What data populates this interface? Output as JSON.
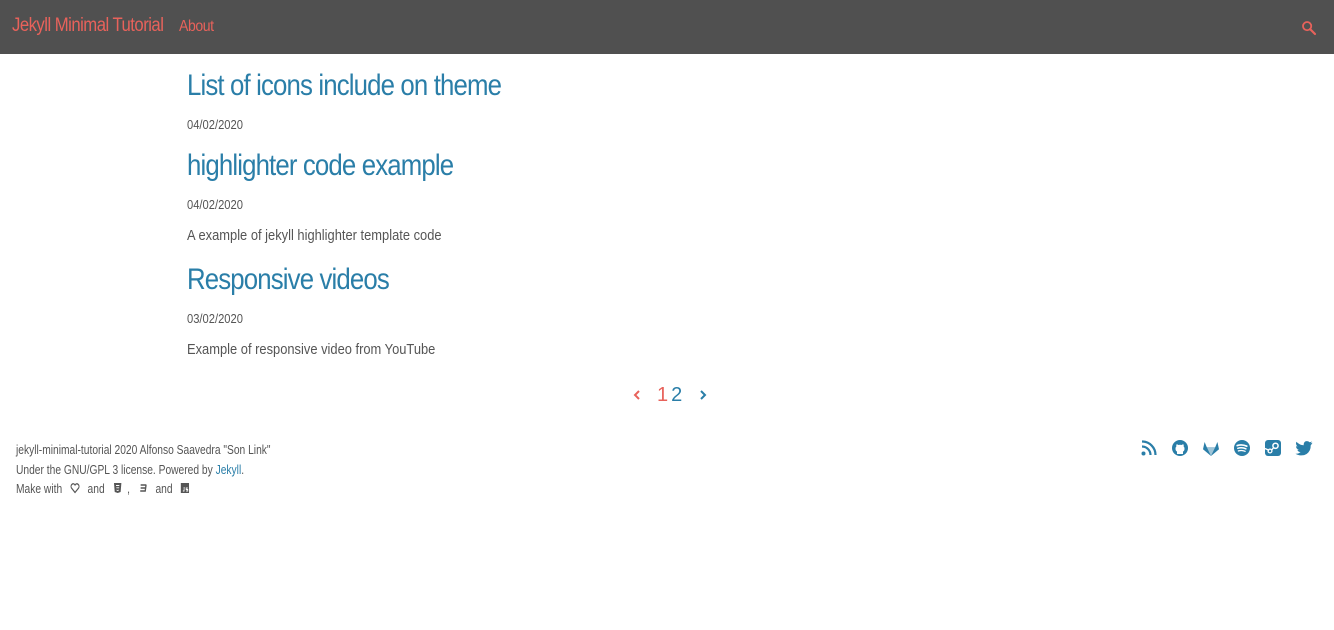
{
  "header": {
    "brand": "Jekyll Minimal Tutorial",
    "nav_about": "About",
    "search_icon": "search-icon"
  },
  "posts": [
    {
      "title": "List of icons include on theme",
      "date": "04/02/2020",
      "excerpt": ""
    },
    {
      "title": "highlighter code example",
      "date": "04/02/2020",
      "excerpt": "A example of jekyll highlighter template code"
    },
    {
      "title": "Responsive videos",
      "date": "03/02/2020",
      "excerpt": "Example of responsive video from YouTube"
    }
  ],
  "pagination": {
    "current": "1",
    "next_page": "2"
  },
  "footer": {
    "line1": "jekyll-minimal-tutorial 2020 Alfonso Saavedra \"Son Link\"",
    "line2_prefix": "Under the GNU/GPL 3 license. Powered by ",
    "line2_link": "Jekyll",
    "line2_suffix": ".",
    "line3_make": "Make with",
    "line3_and1": "and",
    "line3_comma": ",",
    "line3_and2": "and"
  },
  "social": [
    "rss-icon",
    "github-icon",
    "gitlab-icon",
    "spotify-icon",
    "steam-icon",
    "twitter-icon"
  ],
  "colors": {
    "accent_red": "#e8625b",
    "link_blue": "#2a7ea8",
    "topbar": "#505050",
    "text": "#555555"
  }
}
